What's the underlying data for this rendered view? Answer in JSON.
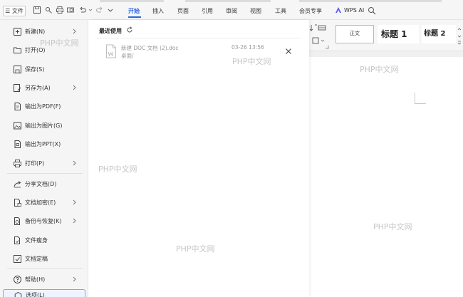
{
  "toolbar": {
    "menu_label": "☰ 文件",
    "tabs": [
      "开始",
      "插入",
      "页面",
      "引用",
      "审阅",
      "视图",
      "工具",
      "会员专享"
    ],
    "active_tab": "开始",
    "ai_label": "WPS AI",
    "accent_color": "#2a66e6"
  },
  "styles": {
    "normal": "正文",
    "heading1": "标题 1",
    "heading2": "标题 2"
  },
  "file_menu": {
    "items": [
      {
        "label": "新建(N)",
        "icon": "new-doc-icon",
        "has_submenu": true
      },
      {
        "label": "打开(O)",
        "icon": "folder-icon",
        "has_submenu": false
      },
      {
        "label": "保存(S)",
        "icon": "save-icon",
        "has_submenu": false
      },
      {
        "label": "另存为(A)",
        "icon": "save-as-icon",
        "has_submenu": true
      },
      {
        "label": "输出为PDF(F)",
        "icon": "pdf-icon",
        "has_submenu": false
      },
      {
        "label": "输出为图片(G)",
        "icon": "image-icon",
        "has_submenu": false
      },
      {
        "label": "输出为PPT(X)",
        "icon": "ppt-icon",
        "has_submenu": false
      },
      {
        "label": "打印(P)",
        "icon": "printer-icon",
        "has_submenu": true
      },
      {
        "label": "分享文档(D)",
        "icon": "share-icon",
        "has_submenu": false
      },
      {
        "label": "文档加密(E)",
        "icon": "lock-doc-icon",
        "has_submenu": true
      },
      {
        "label": "备份与恢复(K)",
        "icon": "backup-icon",
        "has_submenu": true
      },
      {
        "label": "文件瘦身",
        "icon": "slim-icon",
        "has_submenu": false
      },
      {
        "label": "文档定稿",
        "icon": "finalize-icon",
        "has_submenu": false
      },
      {
        "label": "帮助(H)",
        "icon": "help-icon",
        "has_submenu": true
      },
      {
        "label": "选项(L)",
        "icon": "settings-icon",
        "has_submenu": false
      }
    ]
  },
  "recent": {
    "title": "最近使用",
    "files": [
      {
        "name": "新建 DOC 文档 (2).doc",
        "path": "桌面/",
        "time": "03-26 13:56"
      }
    ]
  },
  "watermark": "PHP中文网"
}
